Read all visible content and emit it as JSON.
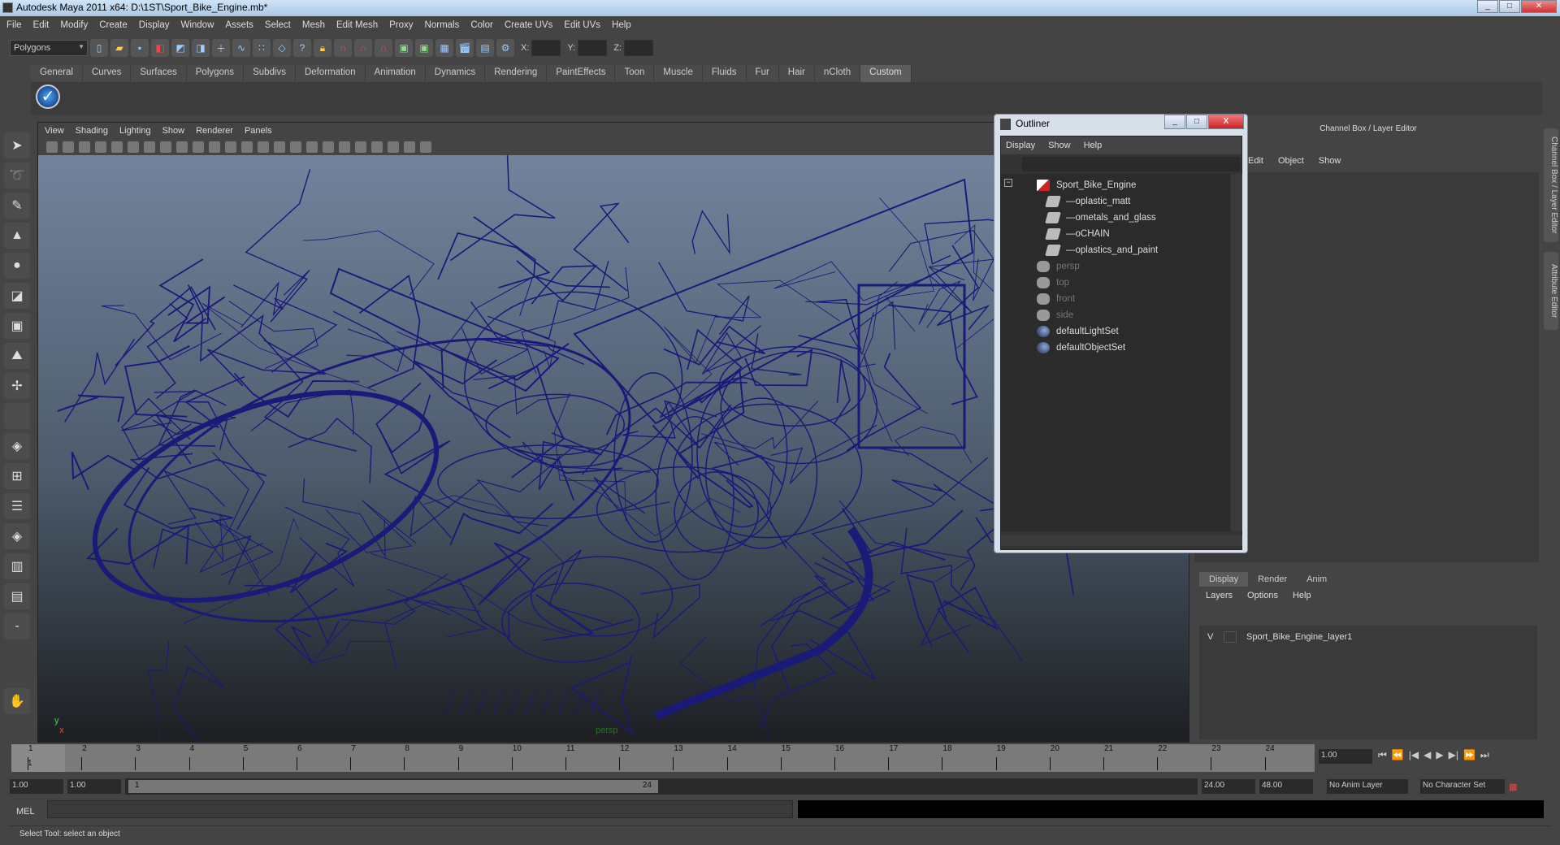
{
  "window": {
    "title": "Autodesk Maya 2011 x64: D:\\1ST\\Sport_Bike_Engine.mb*"
  },
  "menubar": [
    "File",
    "Edit",
    "Modify",
    "Create",
    "Display",
    "Window",
    "Assets",
    "Select",
    "Mesh",
    "Edit Mesh",
    "Proxy",
    "Normals",
    "Color",
    "Create UVs",
    "Edit UVs",
    "Help"
  ],
  "toolbar": {
    "mode": "Polygons",
    "x_label": "X:",
    "y_label": "Y:",
    "z_label": "Z:"
  },
  "shelf": {
    "tabs": [
      "General",
      "Curves",
      "Surfaces",
      "Polygons",
      "Subdivs",
      "Deformation",
      "Animation",
      "Dynamics",
      "Rendering",
      "PaintEffects",
      "Toon",
      "Muscle",
      "Fluids",
      "Fur",
      "Hair",
      "nCloth",
      "Custom"
    ],
    "active": "Custom"
  },
  "viewport": {
    "menu": [
      "View",
      "Shading",
      "Lighting",
      "Show",
      "Renderer",
      "Panels"
    ],
    "camera": "persp",
    "axis_y": "y",
    "axis_x": "x",
    "wire_color": "#1a1a78"
  },
  "outliner": {
    "title": "Outliner",
    "menu": [
      "Display",
      "Show",
      "Help"
    ],
    "items": [
      {
        "label": "Sport_Bike_Engine",
        "icon": "transform",
        "indent": 0,
        "dim": false
      },
      {
        "label": "plastic_matt",
        "icon": "mesh",
        "indent": 1,
        "dim": false
      },
      {
        "label": "metals_and_glass",
        "icon": "mesh",
        "indent": 1,
        "dim": false
      },
      {
        "label": "CHAIN",
        "icon": "mesh",
        "indent": 1,
        "dim": false
      },
      {
        "label": "plastics_and_paint",
        "icon": "mesh",
        "indent": 1,
        "dim": false
      },
      {
        "label": "persp",
        "icon": "camera",
        "indent": 0,
        "dim": true
      },
      {
        "label": "top",
        "icon": "camera",
        "indent": 0,
        "dim": true
      },
      {
        "label": "front",
        "icon": "camera",
        "indent": 0,
        "dim": true
      },
      {
        "label": "side",
        "icon": "camera",
        "indent": 0,
        "dim": true
      },
      {
        "label": "defaultLightSet",
        "icon": "set",
        "indent": 0,
        "dim": false
      },
      {
        "label": "defaultObjectSet",
        "icon": "set",
        "indent": 0,
        "dim": false
      }
    ]
  },
  "channelbox": {
    "title": "Channel Box / Layer Editor",
    "menu": [
      "Edit",
      "Object",
      "Show"
    ]
  },
  "sidetabs": [
    "Channel Box / Layer Editor",
    "Attribute Editor"
  ],
  "layers": {
    "tabs": [
      "Display",
      "Render",
      "Anim"
    ],
    "menu": [
      "Layers",
      "Options",
      "Help"
    ],
    "rows": [
      {
        "visible": "V",
        "name": "Sport_Bike_Engine_layer1"
      }
    ]
  },
  "timeline": {
    "frames": [
      "1",
      "2",
      "3",
      "4",
      "5",
      "6",
      "7",
      "8",
      "9",
      "10",
      "11",
      "12",
      "13",
      "14",
      "15",
      "16",
      "17",
      "18",
      "19",
      "20",
      "21",
      "22",
      "23",
      "24"
    ],
    "current_marker": "1",
    "current_frame": "1.00"
  },
  "range": {
    "start": "1.00",
    "anim_start": "1.00",
    "slider_start": "1",
    "slider_end": "24",
    "end": "24.00",
    "anim_end": "48.00",
    "anim_layer": "No Anim Layer",
    "char_set": "No Character Set"
  },
  "mel": {
    "label": "MEL"
  },
  "status": "Select Tool: select an object"
}
